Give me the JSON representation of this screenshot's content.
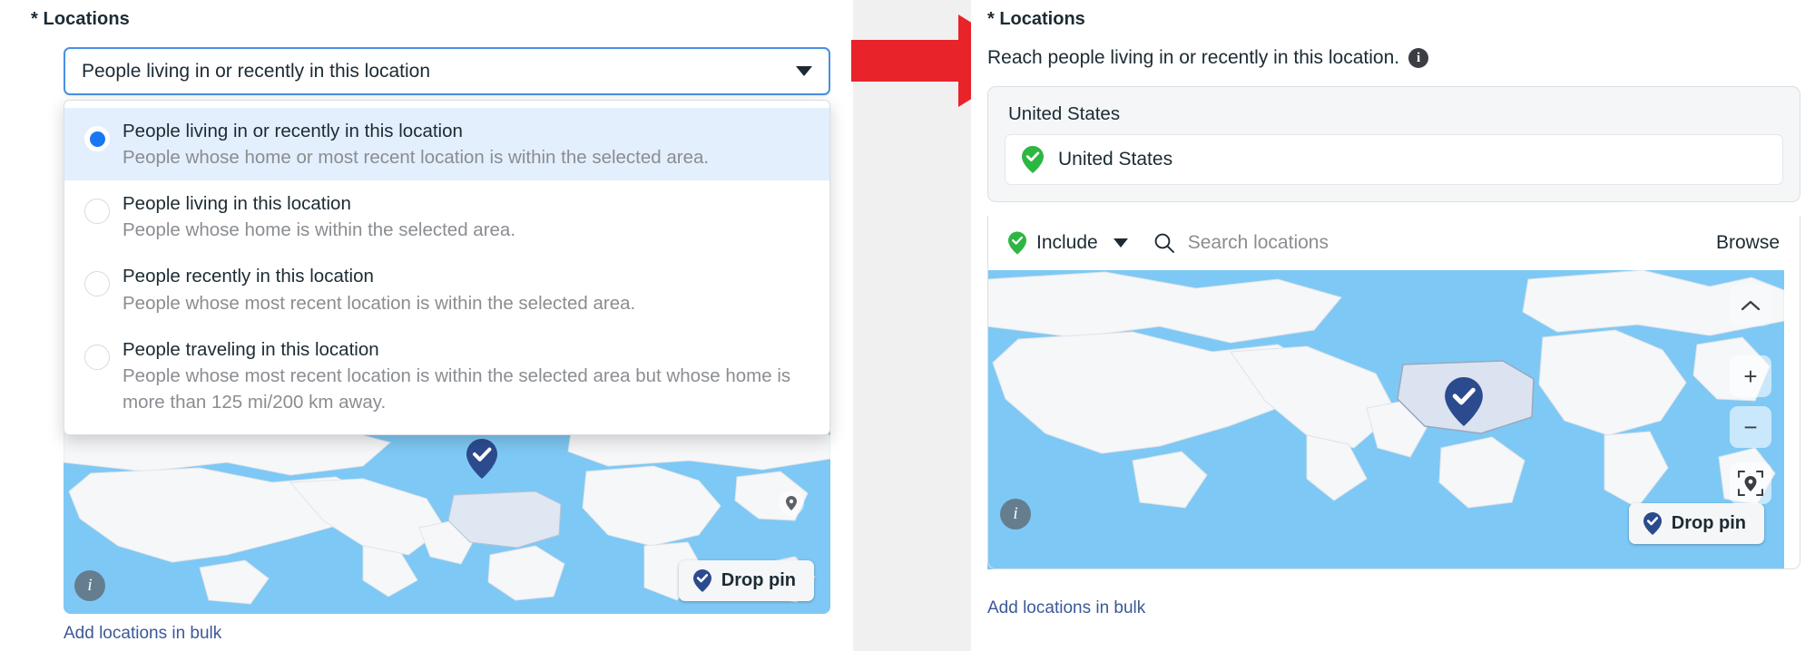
{
  "left_panel": {
    "field_label": "* Locations",
    "select": {
      "value": "People living in or recently in this location",
      "caret_icon": "chevron-down-icon"
    },
    "dropdown": {
      "options": [
        {
          "title": "People living in or recently in this location",
          "desc": "People whose home or most recent location is within the selected area.",
          "selected": true
        },
        {
          "title": "People living in this location",
          "desc": "People whose home is within the selected area.",
          "selected": false
        },
        {
          "title": "People recently in this location",
          "desc": "People whose most recent location is within the selected area.",
          "selected": false
        },
        {
          "title": "People traveling in this location",
          "desc": "People whose most recent location is within the selected area but whose home is more than 125 mi/200 km away.",
          "selected": false
        }
      ]
    },
    "map": {
      "info_badge": "i",
      "drop_pin_label": "Drop pin",
      "drop_pin_icon": "map-pin-check-icon"
    },
    "bulk_link": "Add locations in bulk"
  },
  "right_panel": {
    "field_label": "* Locations",
    "subtitle": "Reach people living in or recently in this location.",
    "info_icon_glyph": "i",
    "location_card": {
      "title": "United States",
      "chip_label": "United States",
      "chip_icon": "map-pin-check-green-icon"
    },
    "toolbar": {
      "include_label": "Include",
      "include_icon": "map-pin-check-green-icon",
      "caret_icon": "chevron-down-icon",
      "search_icon": "search-icon",
      "search_placeholder": "Search locations",
      "browse_label": "Browse"
    },
    "map": {
      "info_badge": "i",
      "drop_pin_label": "Drop pin",
      "drop_pin_icon": "map-pin-check-icon",
      "controls": [
        {
          "name": "collapse",
          "glyph": "⌃"
        },
        {
          "name": "zoom-in",
          "glyph": "+"
        },
        {
          "name": "zoom-out",
          "glyph": "−"
        },
        {
          "name": "locate",
          "glyph": "pin"
        }
      ]
    },
    "bulk_link": "Add locations in bulk"
  },
  "annotation": {
    "arrow_icon": "right-arrow-annotation",
    "arrow_color": "#e8232a"
  },
  "colors": {
    "accent_blue": "#1877f2",
    "focus_border": "#4a90e2",
    "link_blue": "#3b5998",
    "green_pin": "#2db742",
    "navy_pin": "#2c4b8e",
    "map_water": "#7ec8f5",
    "map_land": "#f6f7f9",
    "selected_row_bg": "#e3effd",
    "muted_text": "#8a8d91"
  }
}
